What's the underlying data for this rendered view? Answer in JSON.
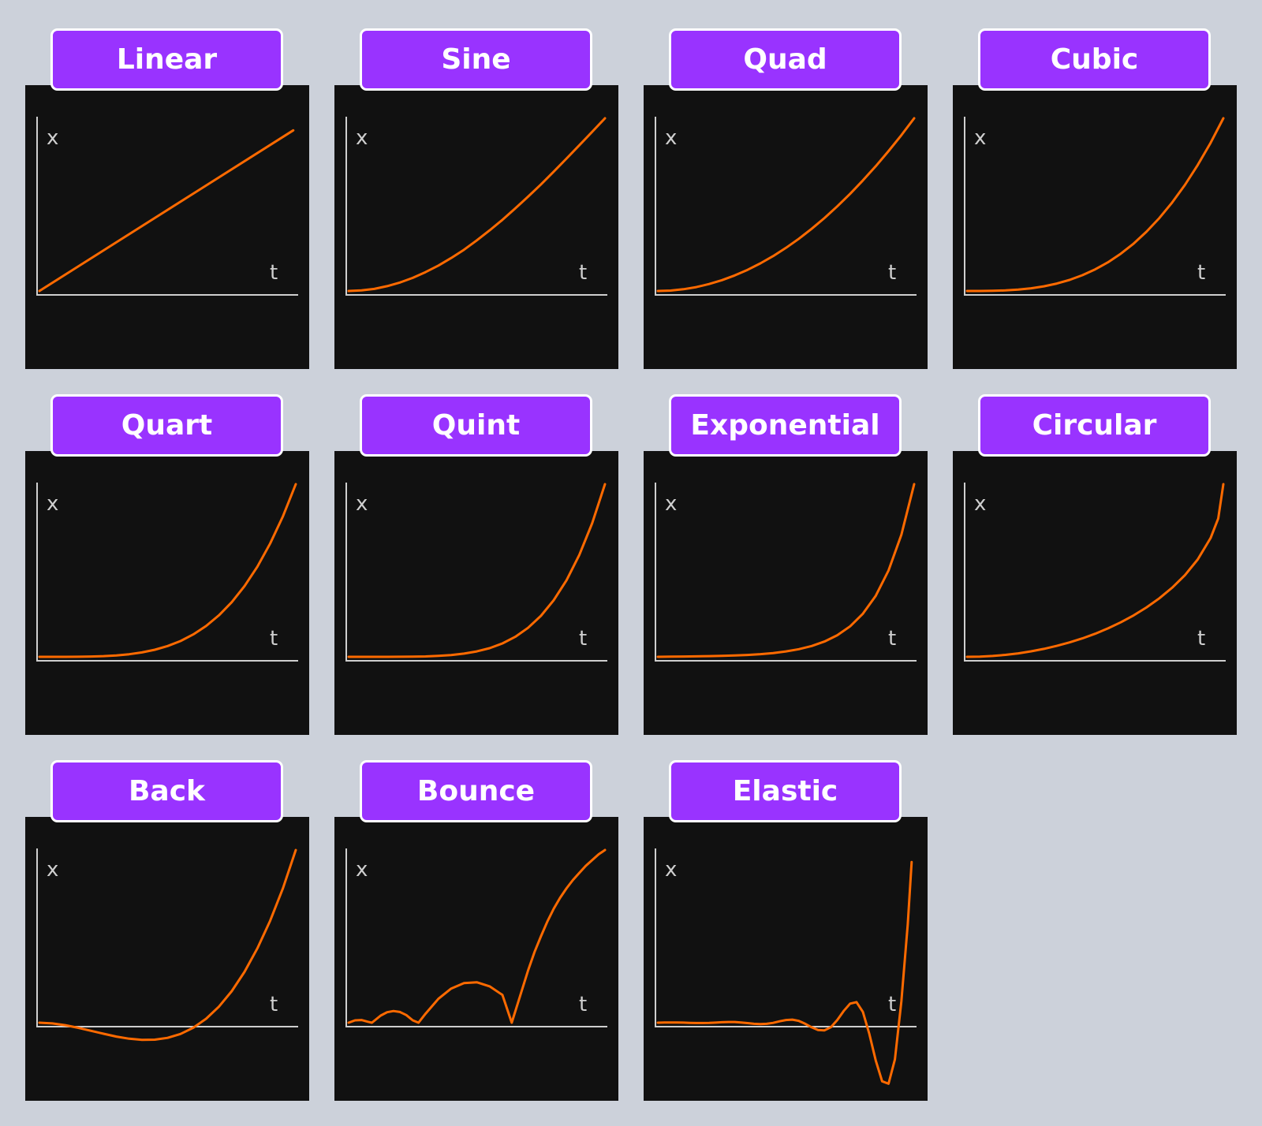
{
  "page": {
    "background": "#ccd1da"
  },
  "style": {
    "label_color": "#9933ff",
    "label_border": "#ffffff",
    "card_color": "#111111",
    "curve_color": "#ff6a00",
    "axis_color": "#cfcfcf"
  },
  "chart_data": [
    {
      "type": "line",
      "title": "Linear",
      "xlabel": "t",
      "ylabel": "x",
      "xlim": [
        0,
        1
      ],
      "ylim": [
        0,
        1
      ],
      "grid": false,
      "x": [
        0,
        0.99
      ],
      "y": [
        0,
        0.93
      ]
    },
    {
      "type": "line",
      "title": "Sine",
      "xlabel": "t",
      "ylabel": "x",
      "xlim": [
        0,
        1
      ],
      "ylim": [
        0,
        1
      ],
      "grid": false,
      "x": [
        0,
        0.05,
        0.1,
        0.15,
        0.2,
        0.25,
        0.3,
        0.35,
        0.4,
        0.45,
        0.5,
        0.55,
        0.6,
        0.65,
        0.7,
        0.75,
        0.8,
        0.85,
        0.9,
        0.95,
        1
      ],
      "y": [
        0,
        0.003,
        0.012,
        0.028,
        0.049,
        0.076,
        0.109,
        0.147,
        0.191,
        0.239,
        0.293,
        0.351,
        0.412,
        0.478,
        0.546,
        0.617,
        0.691,
        0.767,
        0.844,
        0.922,
        1
      ]
    },
    {
      "type": "line",
      "title": "Quad",
      "xlabel": "t",
      "ylabel": "x",
      "xlim": [
        0,
        1
      ],
      "ylim": [
        0,
        1
      ],
      "grid": false,
      "x": [
        0,
        0.05,
        0.1,
        0.15,
        0.2,
        0.25,
        0.3,
        0.35,
        0.4,
        0.45,
        0.5,
        0.55,
        0.6,
        0.65,
        0.7,
        0.75,
        0.8,
        0.85,
        0.9,
        0.95,
        1
      ],
      "y": [
        0,
        0.0025,
        0.01,
        0.0225,
        0.04,
        0.0625,
        0.09,
        0.1225,
        0.16,
        0.2025,
        0.25,
        0.3025,
        0.36,
        0.4225,
        0.49,
        0.5625,
        0.64,
        0.7225,
        0.81,
        0.9025,
        1
      ]
    },
    {
      "type": "line",
      "title": "Cubic",
      "xlabel": "t",
      "ylabel": "x",
      "xlim": [
        0,
        1
      ],
      "ylim": [
        0,
        1
      ],
      "grid": false,
      "x": [
        0,
        0.05,
        0.1,
        0.15,
        0.2,
        0.25,
        0.3,
        0.35,
        0.4,
        0.45,
        0.5,
        0.55,
        0.6,
        0.65,
        0.7,
        0.75,
        0.8,
        0.85,
        0.9,
        0.95,
        1
      ],
      "y": [
        0,
        0.0001,
        0.001,
        0.0034,
        0.008,
        0.0156,
        0.027,
        0.0429,
        0.064,
        0.0911,
        0.125,
        0.1664,
        0.216,
        0.2746,
        0.343,
        0.4219,
        0.512,
        0.6141,
        0.729,
        0.8574,
        1
      ]
    },
    {
      "type": "line",
      "title": "Quart",
      "xlabel": "t",
      "ylabel": "x",
      "xlim": [
        0,
        1
      ],
      "ylim": [
        0,
        1
      ],
      "grid": false,
      "x": [
        0,
        0.05,
        0.1,
        0.15,
        0.2,
        0.25,
        0.3,
        0.35,
        0.4,
        0.45,
        0.5,
        0.55,
        0.6,
        0.65,
        0.7,
        0.75,
        0.8,
        0.85,
        0.9,
        0.95,
        1
      ],
      "y": [
        0,
        0,
        0.0001,
        0.0005,
        0.0016,
        0.0039,
        0.0081,
        0.015,
        0.0256,
        0.041,
        0.0625,
        0.0915,
        0.1296,
        0.1785,
        0.2401,
        0.3164,
        0.4096,
        0.522,
        0.6561,
        0.8145,
        1
      ]
    },
    {
      "type": "line",
      "title": "Quint",
      "xlabel": "t",
      "ylabel": "x",
      "xlim": [
        0,
        1
      ],
      "ylim": [
        0,
        1
      ],
      "grid": false,
      "x": [
        0,
        0.05,
        0.1,
        0.15,
        0.2,
        0.25,
        0.3,
        0.35,
        0.4,
        0.45,
        0.5,
        0.55,
        0.6,
        0.65,
        0.7,
        0.75,
        0.8,
        0.85,
        0.9,
        0.95,
        1
      ],
      "y": [
        0,
        0,
        0,
        0.0001,
        0.0003,
        0.001,
        0.0024,
        0.0053,
        0.0102,
        0.0185,
        0.0313,
        0.0503,
        0.0778,
        0.116,
        0.1681,
        0.2373,
        0.3277,
        0.4437,
        0.5905,
        0.7738,
        1
      ]
    },
    {
      "type": "line",
      "title": "Exponential",
      "xlabel": "t",
      "ylabel": "x",
      "xlim": [
        0,
        1
      ],
      "ylim": [
        0,
        1
      ],
      "grid": false,
      "x": [
        0,
        0.05,
        0.1,
        0.15,
        0.2,
        0.25,
        0.3,
        0.35,
        0.4,
        0.45,
        0.5,
        0.55,
        0.6,
        0.65,
        0.7,
        0.75,
        0.8,
        0.85,
        0.9,
        0.95,
        1
      ],
      "y": [
        0,
        0.0014,
        0.002,
        0.0028,
        0.0039,
        0.0055,
        0.0078,
        0.011,
        0.0156,
        0.0221,
        0.0313,
        0.0442,
        0.0625,
        0.0884,
        0.125,
        0.1768,
        0.25,
        0.3536,
        0.5,
        0.7071,
        1
      ]
    },
    {
      "type": "line",
      "title": "Circular",
      "xlabel": "t",
      "ylabel": "x",
      "xlim": [
        0,
        1
      ],
      "ylim": [
        0,
        1
      ],
      "grid": false,
      "x": [
        0,
        0.05,
        0.1,
        0.15,
        0.2,
        0.25,
        0.3,
        0.35,
        0.4,
        0.45,
        0.5,
        0.55,
        0.6,
        0.65,
        0.7,
        0.75,
        0.8,
        0.85,
        0.9,
        0.95,
        0.98,
        1
      ],
      "y": [
        0,
        0.0013,
        0.005,
        0.0113,
        0.0202,
        0.0318,
        0.0461,
        0.0633,
        0.0835,
        0.1069,
        0.134,
        0.1648,
        0.2,
        0.2401,
        0.2859,
        0.3386,
        0.4,
        0.4732,
        0.5641,
        0.6878,
        0.801,
        1
      ]
    },
    {
      "type": "line",
      "title": "Back",
      "xlabel": "t",
      "ylabel": "x",
      "xlim": [
        0,
        1
      ],
      "ylim": [
        0,
        1
      ],
      "grid": false,
      "x": [
        0,
        0.05,
        0.1,
        0.15,
        0.2,
        0.25,
        0.3,
        0.35,
        0.4,
        0.45,
        0.5,
        0.55,
        0.6,
        0.65,
        0.7,
        0.75,
        0.8,
        0.85,
        0.9,
        0.95,
        1
      ],
      "y": [
        0,
        -0.0039,
        -0.0143,
        -0.0292,
        -0.0465,
        -0.0641,
        -0.0802,
        -0.0926,
        -0.0994,
        -0.0984,
        -0.0877,
        -0.0653,
        -0.029,
        0.023,
        0.0928,
        0.1825,
        0.2943,
        0.4304,
        0.5905,
        0.7794,
        1
      ]
    },
    {
      "type": "line",
      "title": "Bounce",
      "xlabel": "t",
      "ylabel": "x",
      "xlim": [
        0,
        1
      ],
      "ylim": [
        0,
        1
      ],
      "grid": false,
      "x": [
        0,
        0.025,
        0.05,
        0.075,
        0.0909,
        0.125,
        0.15,
        0.175,
        0.2,
        0.225,
        0.25,
        0.2727,
        0.3,
        0.35,
        0.4,
        0.45,
        0.5,
        0.55,
        0.6,
        0.6364,
        0.675,
        0.7,
        0.725,
        0.75,
        0.775,
        0.8,
        0.825,
        0.85,
        0.875,
        0.9,
        0.925,
        0.95,
        0.975,
        1
      ],
      "y": [
        0,
        0.0135,
        0.0154,
        0.0055,
        0,
        0.0413,
        0.0607,
        0.0677,
        0.0622,
        0.0442,
        0.0137,
        0,
        0.0522,
        0.1385,
        0.1975,
        0.2293,
        0.2344,
        0.2106,
        0.1606,
        0,
        0.184,
        0.3025,
        0.408,
        0.5,
        0.5856,
        0.66,
        0.7231,
        0.7787,
        0.8267,
        0.8678,
        0.9083,
        0.9421,
        0.9751,
        1
      ]
    },
    {
      "type": "line",
      "title": "Elastic",
      "xlabel": "t",
      "ylabel": "x",
      "xlim": [
        0,
        1
      ],
      "ylim": [
        -0.4,
        1
      ],
      "grid": false,
      "x": [
        0,
        0.025,
        0.05,
        0.075,
        0.1,
        0.125,
        0.15,
        0.175,
        0.2,
        0.225,
        0.25,
        0.275,
        0.3,
        0.325,
        0.35,
        0.375,
        0.4,
        0.425,
        0.45,
        0.475,
        0.5,
        0.525,
        0.55,
        0.575,
        0.6,
        0.625,
        0.65,
        0.675,
        0.7,
        0.725,
        0.75,
        0.775,
        0.8,
        0.825,
        0.85,
        0.875,
        0.9,
        0.925,
        0.95,
        0.975,
        0.99
      ],
      "y": [
        0,
        0.0011,
        0.0014,
        0.0012,
        0.0004,
        -0.0007,
        -0.0016,
        -0.0019,
        -0.0012,
        0.0006,
        0.0027,
        0.0043,
        0.0039,
        0.0015,
        -0.0022,
        -0.0066,
        -0.0078,
        -0.0062,
        -0.0011,
        0.0084,
        0.0157,
        0.0176,
        0.0106,
        -0.0063,
        -0.0266,
        -0.0422,
        -0.0442,
        -0.0261,
        0.0156,
        0.0676,
        0.1104,
        0.1193,
        0.0625,
        -0.0641,
        -0.2188,
        -0.3393,
        -0.3536,
        -0.2123,
        0.1243,
        0.5712,
        0.93
      ]
    }
  ]
}
